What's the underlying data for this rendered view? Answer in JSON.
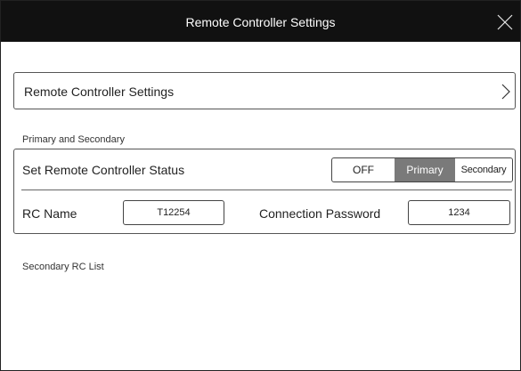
{
  "window": {
    "title": "Remote Controller Settings",
    "close_icon": "close-icon"
  },
  "nav": {
    "label": "Remote Controller Settings",
    "chevron_icon": "chevron-right-icon"
  },
  "primary_secondary": {
    "section_label": "Primary and Secondary",
    "status_label": "Set Remote Controller Status",
    "options": [
      "OFF",
      "Primary",
      "Secondary"
    ],
    "selected": "Primary",
    "rc_name_label": "RC Name",
    "rc_name_value": "T12254",
    "password_label": "Connection Password",
    "password_value": "1234"
  },
  "secondary_list": {
    "label": "Secondary RC List"
  },
  "colors": {
    "titlebar": "#111111",
    "selected_segment": "#7a7a7a"
  }
}
